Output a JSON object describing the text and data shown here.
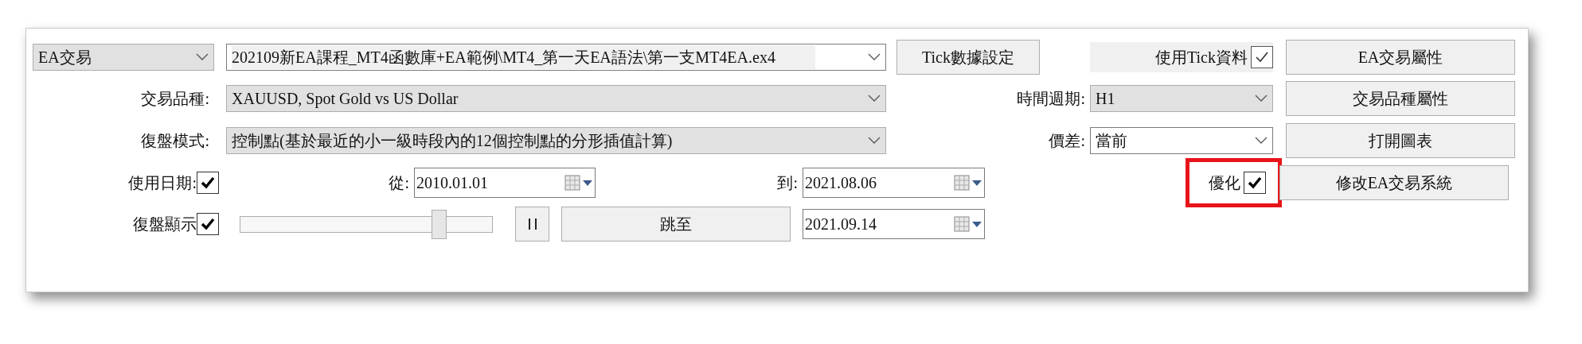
{
  "mode_select": {
    "value": "EA交易",
    "disabled": true
  },
  "ea_path": {
    "value": "202109新EA課程_MT4函數庫+EA範例\\MT4_第一天EA語法\\第一支MT4EA.ex4",
    "disabled": false
  },
  "tick_settings_button": "Tick數據設定",
  "use_tick": {
    "label": "使用Tick資料",
    "checked": true
  },
  "side_buttons": [
    "EA交易屬性",
    "交易品種屬性",
    "打開圖表",
    "修改EA交易系統"
  ],
  "symbol": {
    "label": "交易品種:",
    "value": "XAUUSD, Spot Gold vs US Dollar",
    "disabled": true
  },
  "model": {
    "label": "復盤模式:",
    "value": "控制點(基於最近的小一級時段內的12個控制點的分形插值計算)",
    "disabled": true
  },
  "period": {
    "label": "時間週期:",
    "value": "H1",
    "disabled": true
  },
  "spread": {
    "label": "價差:",
    "value": "當前",
    "disabled": false
  },
  "use_date": {
    "label": "使用日期:",
    "checked": true
  },
  "from_date": {
    "label": "從:",
    "value": "2010.01.01"
  },
  "to_date": {
    "label": "到:",
    "value": "2021.08.06"
  },
  "visual_mode": {
    "label": "復盤顯示",
    "checked": true
  },
  "speed_slider": {
    "level": 0.79
  },
  "skip_button": "跳至",
  "skip_date": {
    "value": "2021.09.14"
  },
  "optimization": {
    "label": "優化",
    "checked": true,
    "highlighted": true
  }
}
